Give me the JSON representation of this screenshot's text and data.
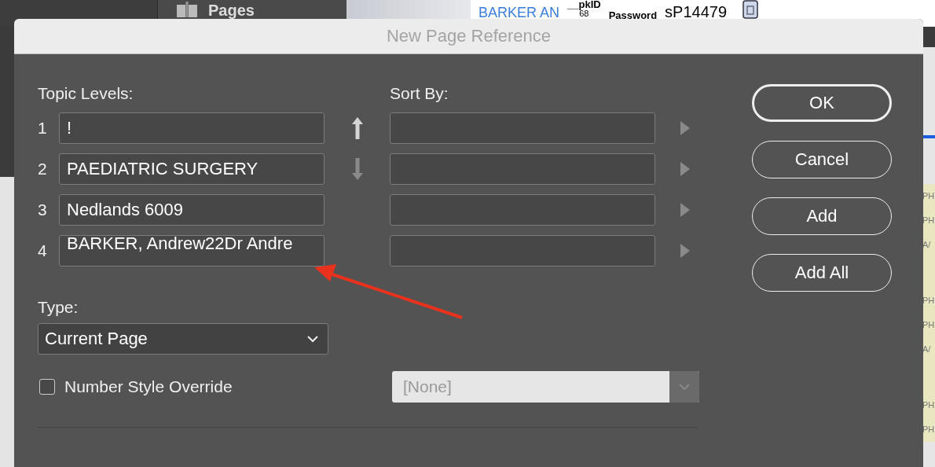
{
  "background": {
    "panel_label": "Pages",
    "document": {
      "name_link": "BARKER AN",
      "number": "68",
      "field_header": "__pkID",
      "password_label": "Password",
      "password_value": "sP14479"
    },
    "side_cells": [
      {
        "text": "PH"
      },
      {
        "text": "PH"
      },
      {
        "text": "A/"
      },
      {
        "text": "PH"
      },
      {
        "text": "PH"
      },
      {
        "text": "A/"
      },
      {
        "text": "PH"
      },
      {
        "text": "PH"
      }
    ]
  },
  "dialog": {
    "title": "New Page Reference",
    "topic_levels": {
      "label": "Topic Levels:",
      "rows": [
        {
          "number": "1",
          "value": "!"
        },
        {
          "number": "2",
          "value": "PAEDIATRIC SURGERY"
        },
        {
          "number": "3",
          "value": "Nedlands 6009"
        },
        {
          "number": "4",
          "value": "BARKER, Andrew22Dr Andre"
        }
      ]
    },
    "move_buttons": [
      {
        "kind": "up",
        "disabled": false
      },
      {
        "kind": "down",
        "disabled": true
      }
    ],
    "sort_by": {
      "label": "Sort By:"
    },
    "type": {
      "label": "Type:",
      "value": "Current Page"
    },
    "number_style_override": {
      "label": "Number Style Override",
      "checked": false
    },
    "number_style": {
      "value": "[None]",
      "disabled": true
    },
    "buttons": [
      {
        "label": "OK",
        "default": true
      },
      {
        "label": "Cancel",
        "default": false
      },
      {
        "label": "Add",
        "default": false
      },
      {
        "label": "Add All",
        "default": false
      }
    ]
  }
}
